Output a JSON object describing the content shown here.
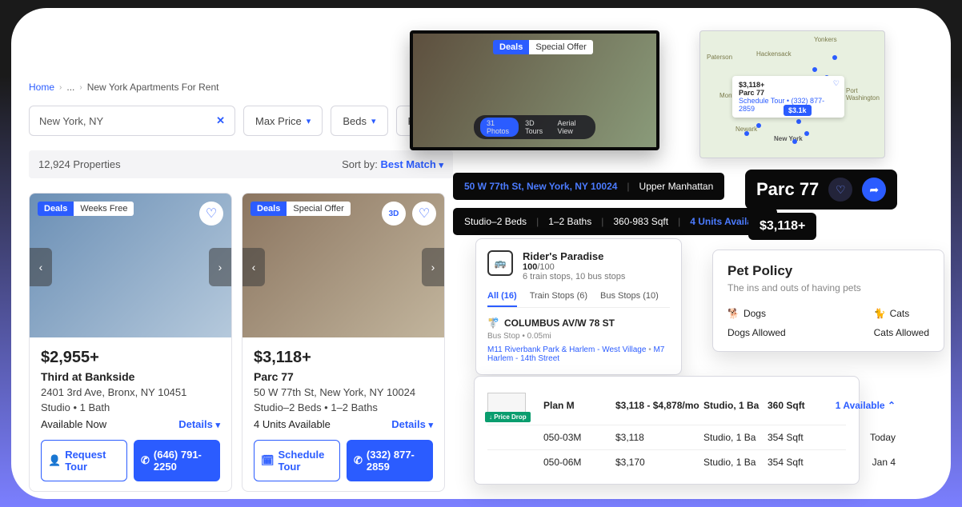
{
  "breadcrumb": {
    "home": "Home",
    "ellipsis": "...",
    "current": "New York Apartments For Rent"
  },
  "search": {
    "value": "New York, NY"
  },
  "filters": {
    "maxprice": "Max Price",
    "beds": "Beds",
    "more": "Filt"
  },
  "results": {
    "count": "12,924 Properties",
    "sort_label": "Sort by:",
    "sort_value": "Best Match"
  },
  "cards": [
    {
      "deal": "Deals",
      "promo": "Weeks Free",
      "price": "$2,955+",
      "name": "Third at Bankside",
      "addr": "2401 3rd Ave, Bronx, NY 10451",
      "specs": "Studio • 1 Bath",
      "avail": "Available Now",
      "details": "Details",
      "tour": "Request Tour",
      "phone": "(646) 791-2250"
    },
    {
      "deal": "Deals",
      "promo": "Special Offer",
      "threeD": "3D",
      "price": "$3,118+",
      "name": "Parc 77",
      "addr": "50 W 77th St, New York, NY 10024",
      "specs": "Studio–2 Beds • 1–2 Baths",
      "avail": "4 Units Available",
      "details": "Details",
      "tour": "Schedule Tour",
      "phone": "(332) 877-2859"
    }
  ],
  "hero": {
    "deal": "Deals",
    "promo": "Special Offer",
    "pills": {
      "photos": "31 Photos",
      "tours": "3D Tours",
      "aerial": "Aerial View"
    }
  },
  "map": {
    "callout": {
      "price": "$3,118+",
      "name": "Parc 77",
      "link": "Schedule Tour •",
      "phone": "(332) 877-2859"
    },
    "pin": "$3.1k",
    "labels": {
      "a": "Paterson",
      "b": "Yonkers",
      "c": "Hackensack",
      "d": "Montclair",
      "e": "Newark",
      "f": "New York",
      "g": "Port Washington"
    }
  },
  "addr_bar": {
    "addr": "50 W 77th St, New York, NY 10024",
    "hood": "Upper Manhattan"
  },
  "specs_bar": {
    "beds": "Studio–2 Beds",
    "baths": "1–2 Baths",
    "sqft": "360-983 Sqft",
    "units": "4 Units Available"
  },
  "title": {
    "name": "Parc 77",
    "price": "$3,118+"
  },
  "rider": {
    "title": "Rider's Paradise",
    "score": "100",
    "score_max": "/100",
    "sub": "6 train stops, 10 bus stops",
    "tabs": {
      "all": "All (16)",
      "train": "Train Stops (6)",
      "bus": "Bus Stops (10)"
    },
    "stop": "COLUMBUS AV/W 78 ST",
    "stop_meta": "Bus Stop • 0.05mi",
    "routes": {
      "r1": "M11 Riverbank Park & Harlem - West Village",
      "r2": "M7 Harlem - 14th Street"
    }
  },
  "pet": {
    "title": "Pet Policy",
    "sub": "The ins and outs of having pets",
    "dogs_label": "Dogs",
    "dogs_val": "Dogs Allowed",
    "cats_label": "Cats",
    "cats_val": "Cats Allowed"
  },
  "fp": {
    "price_drop": "↓ Price Drop",
    "header": {
      "name": "Plan M",
      "price": "$3,118 - $4,878/mo",
      "bed": "Studio, 1 Ba",
      "sqft": "360 Sqft",
      "avail": "1 Available"
    },
    "rows": [
      {
        "unit": "050-03M",
        "price": "$3,118",
        "bed": "Studio, 1 Ba",
        "sqft": "354 Sqft",
        "avail": "Today"
      },
      {
        "unit": "050-06M",
        "price": "$3,170",
        "bed": "Studio, 1 Ba",
        "sqft": "354 Sqft",
        "avail": "Jan 4"
      }
    ]
  }
}
